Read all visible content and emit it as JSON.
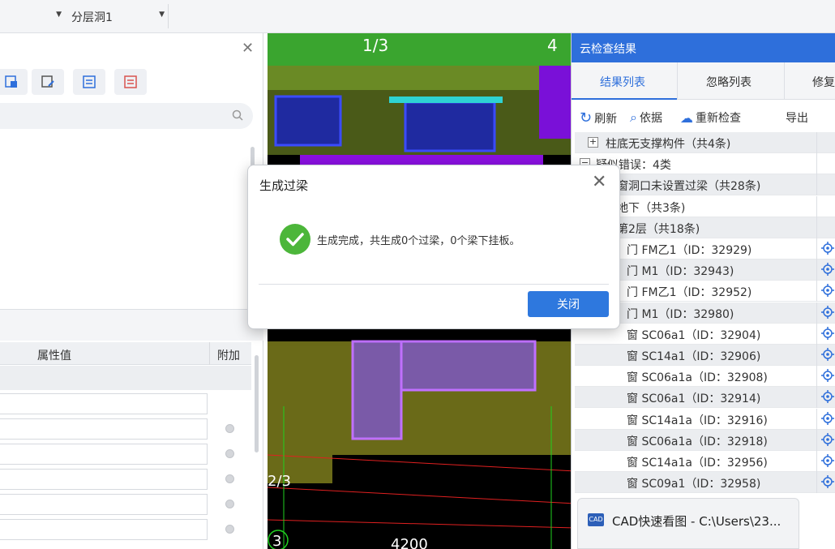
{
  "topbar": {
    "layer_dropdown": "分层洞1"
  },
  "left_bottom": {
    "col_value": "属性值",
    "col_extra": "附加"
  },
  "canvas": {
    "labels": [
      "1/3",
      "4",
      "2/3",
      "3",
      "4200"
    ]
  },
  "result_panel": {
    "title": "云检查结果",
    "tabs": [
      "结果列表",
      "忽略列表",
      "修复"
    ],
    "tools": {
      "refresh": "刷新",
      "basis": "依据",
      "recheck": "重新检查",
      "export": "导出"
    },
    "rows": [
      "柱底无支撑构件（共4条)",
      "疑似错误：4类",
      "窗洞口未设置过梁（共28条)",
      "地下（共3条)",
      "第2层（共18条)",
      "门 FM乙1（ID：32929)",
      "门 M1（ID：32943)",
      "门 FM乙1（ID：32952)",
      "门 M1（ID：32980)",
      "窗 SC06a1（ID：32904)",
      "窗 SC14a1（ID：32906)",
      "窗 SC06a1a（ID：32908)",
      "窗 SC06a1（ID：32914)",
      "窗 SC14a1a（ID：32916)",
      "窗 SC06a1a（ID：32918)",
      "窗 SC14a1a（ID：32956)",
      "窗 SC09a1（ID：32958)"
    ]
  },
  "taskbar_preview": {
    "title": "CAD快速看图 - C:\\Users\\23..."
  },
  "dialog": {
    "title": "生成过梁",
    "message": "生成完成，共生成0个过梁，0个梁下挂板。",
    "close_button": "关闭"
  },
  "colors": {
    "accent": "#2e6fdb",
    "success": "#4cb63a"
  }
}
